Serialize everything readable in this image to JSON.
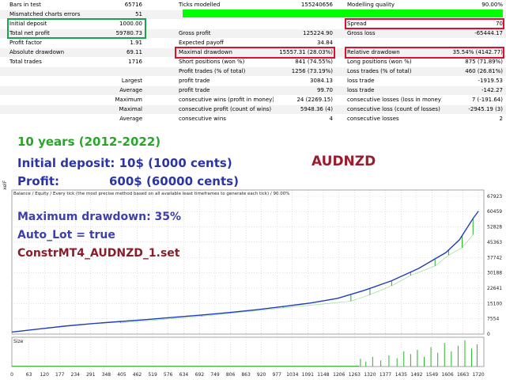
{
  "report": {
    "rows": [
      {
        "label1": "Bars in test",
        "value1": "65716",
        "label2": "Ticks modelled",
        "value2": "155240656",
        "label3": "Modelling quality",
        "value3": "90.00%"
      },
      {
        "label1": "Mismatched charts errors",
        "value1": "51",
        "label2": "",
        "value2": "",
        "label3": "",
        "value3": ""
      },
      {
        "label1": "Initial deposit",
        "value1": "1000.00",
        "label2": "",
        "value2": "",
        "label3": "Spread",
        "value3": "70"
      },
      {
        "label1": "Total net profit",
        "value1": "59780.73",
        "label2": "Gross profit",
        "value2": "125224.90",
        "label3": "Gross loss",
        "value3": "-65444.17"
      },
      {
        "label1": "Profit factor",
        "value1": "1.91",
        "label2": "Expected payoff",
        "value2": "34.84",
        "label3": "",
        "value3": ""
      },
      {
        "label1": "Absolute drawdown",
        "value1": "69.11",
        "label2": "Maximal drawdown",
        "value2": "15557.31 (28.03%)",
        "label3": "Relative drawdown",
        "value3": "35.54% (4142.77)"
      },
      {
        "label1": "Total trades",
        "value1": "1716",
        "label2": "Short positions (won %)",
        "value2": "841 (74.55%)",
        "label3": "Long positions (won %)",
        "value3": "875 (71.89%)"
      },
      {
        "label0": "",
        "label2": "Profit trades (% of total)",
        "value2": "1256 (73.19%)",
        "label3": "Loss trades (% of total)",
        "value3": "460 (26.81%)"
      },
      {
        "label0": "Largest",
        "label2": "profit trade",
        "value2": "3084.13",
        "label3": "loss trade",
        "value3": "-1919.53"
      },
      {
        "label0": "Average",
        "label2": "profit trade",
        "value2": "99.70",
        "label3": "loss trade",
        "value3": "-142.27"
      },
      {
        "label0": "Maximum",
        "label2": "consecutive wins (profit in money)",
        "value2": "24 (2269.15)",
        "label3": "consecutive losses (loss in money)",
        "value3": "7 (-191.64)"
      },
      {
        "label0": "Maximal",
        "label2": "consecutive profit (count of wins)",
        "value2": "5948.36 (4)",
        "label3": "consecutive loss (count of losses)",
        "value3": "-2945.19 (3)"
      },
      {
        "label0": "Average",
        "label2": "consecutive wins",
        "value2": "4",
        "label3": "consecutive losses",
        "value3": "2"
      }
    ],
    "modelling_quality_bar": 0.9,
    "colors": {
      "green_highlight": "#19a34a",
      "red_highlight": "#e0102a",
      "quality_bar": "#00ff00"
    }
  },
  "overlay": {
    "years": "10 years (2012-2022)",
    "deposit": "Initial deposit: 10$ (1000 cents)",
    "profit_label": "Profit:",
    "profit_value": "600$ (60000 cents)",
    "symbol": "AUDNZD",
    "max_drawdown": "Maximum drawdown: 35%",
    "auto_lot": "Auto_Lot = true",
    "set_file": "ConstrMT4_AUDNZD_1.set"
  },
  "chart": {
    "legend": "Balance / Equity / Every tick (the most precise method based on all available least timeframes to generate each tick) / 90.00%",
    "side_label_top": "xelF",
    "side_label_bottom": "Size",
    "colors": {
      "balance": "#1f3fb8",
      "equity": "#26b526",
      "size": "#26b526",
      "grid": "#b0b0b0"
    }
  },
  "chart_data": {
    "type": "line",
    "y_ticks": [
      "67923",
      "60459",
      "52828",
      "45363",
      "37742",
      "30188",
      "22641",
      "15100",
      "7554",
      "0"
    ],
    "x_ticks": [
      "0",
      "63",
      "120",
      "177",
      "234",
      "291",
      "348",
      "405",
      "462",
      "519",
      "576",
      "634",
      "692",
      "749",
      "806",
      "863",
      "920",
      "977",
      "1034",
      "1091",
      "1148",
      "1206",
      "1263",
      "1320",
      "1377",
      "1435",
      "1492",
      "1549",
      "1606",
      "1663",
      "1720"
    ],
    "series": [
      {
        "name": "Balance",
        "x": [
          0,
          100,
          200,
          300,
          400,
          500,
          600,
          700,
          800,
          900,
          1000,
          1100,
          1200,
          1300,
          1400,
          1500,
          1600,
          1650,
          1700,
          1720
        ],
        "y": [
          1000,
          2500,
          4000,
          5200,
          6200,
          7200,
          8300,
          9400,
          10600,
          12000,
          13600,
          15300,
          17600,
          21600,
          26300,
          32400,
          40200,
          46500,
          57000,
          60600
        ]
      },
      {
        "name": "Equity",
        "x": [
          400,
          700,
          1000,
          1250,
          1320,
          1400,
          1470,
          1560,
          1610,
          1660,
          1700
        ],
        "y": [
          5500,
          8800,
          12900,
          16200,
          19400,
          23800,
          28900,
          33600,
          38900,
          42600,
          49000
        ]
      }
    ],
    "ylim": [
      0,
      67923
    ],
    "xlim": [
      0,
      1740
    ],
    "size_bars": [
      {
        "x": 1285,
        "v": 0.28
      },
      {
        "x": 1305,
        "v": 0.18
      },
      {
        "x": 1330,
        "v": 0.35
      },
      {
        "x": 1360,
        "v": 0.22
      },
      {
        "x": 1390,
        "v": 0.4
      },
      {
        "x": 1420,
        "v": 0.3
      },
      {
        "x": 1445,
        "v": 0.55
      },
      {
        "x": 1470,
        "v": 0.45
      },
      {
        "x": 1495,
        "v": 0.6
      },
      {
        "x": 1520,
        "v": 0.35
      },
      {
        "x": 1545,
        "v": 0.7
      },
      {
        "x": 1570,
        "v": 0.5
      },
      {
        "x": 1595,
        "v": 0.85
      },
      {
        "x": 1620,
        "v": 0.55
      },
      {
        "x": 1645,
        "v": 0.75
      },
      {
        "x": 1670,
        "v": 0.95
      },
      {
        "x": 1695,
        "v": 0.65
      },
      {
        "x": 1715,
        "v": 0.8
      }
    ]
  }
}
